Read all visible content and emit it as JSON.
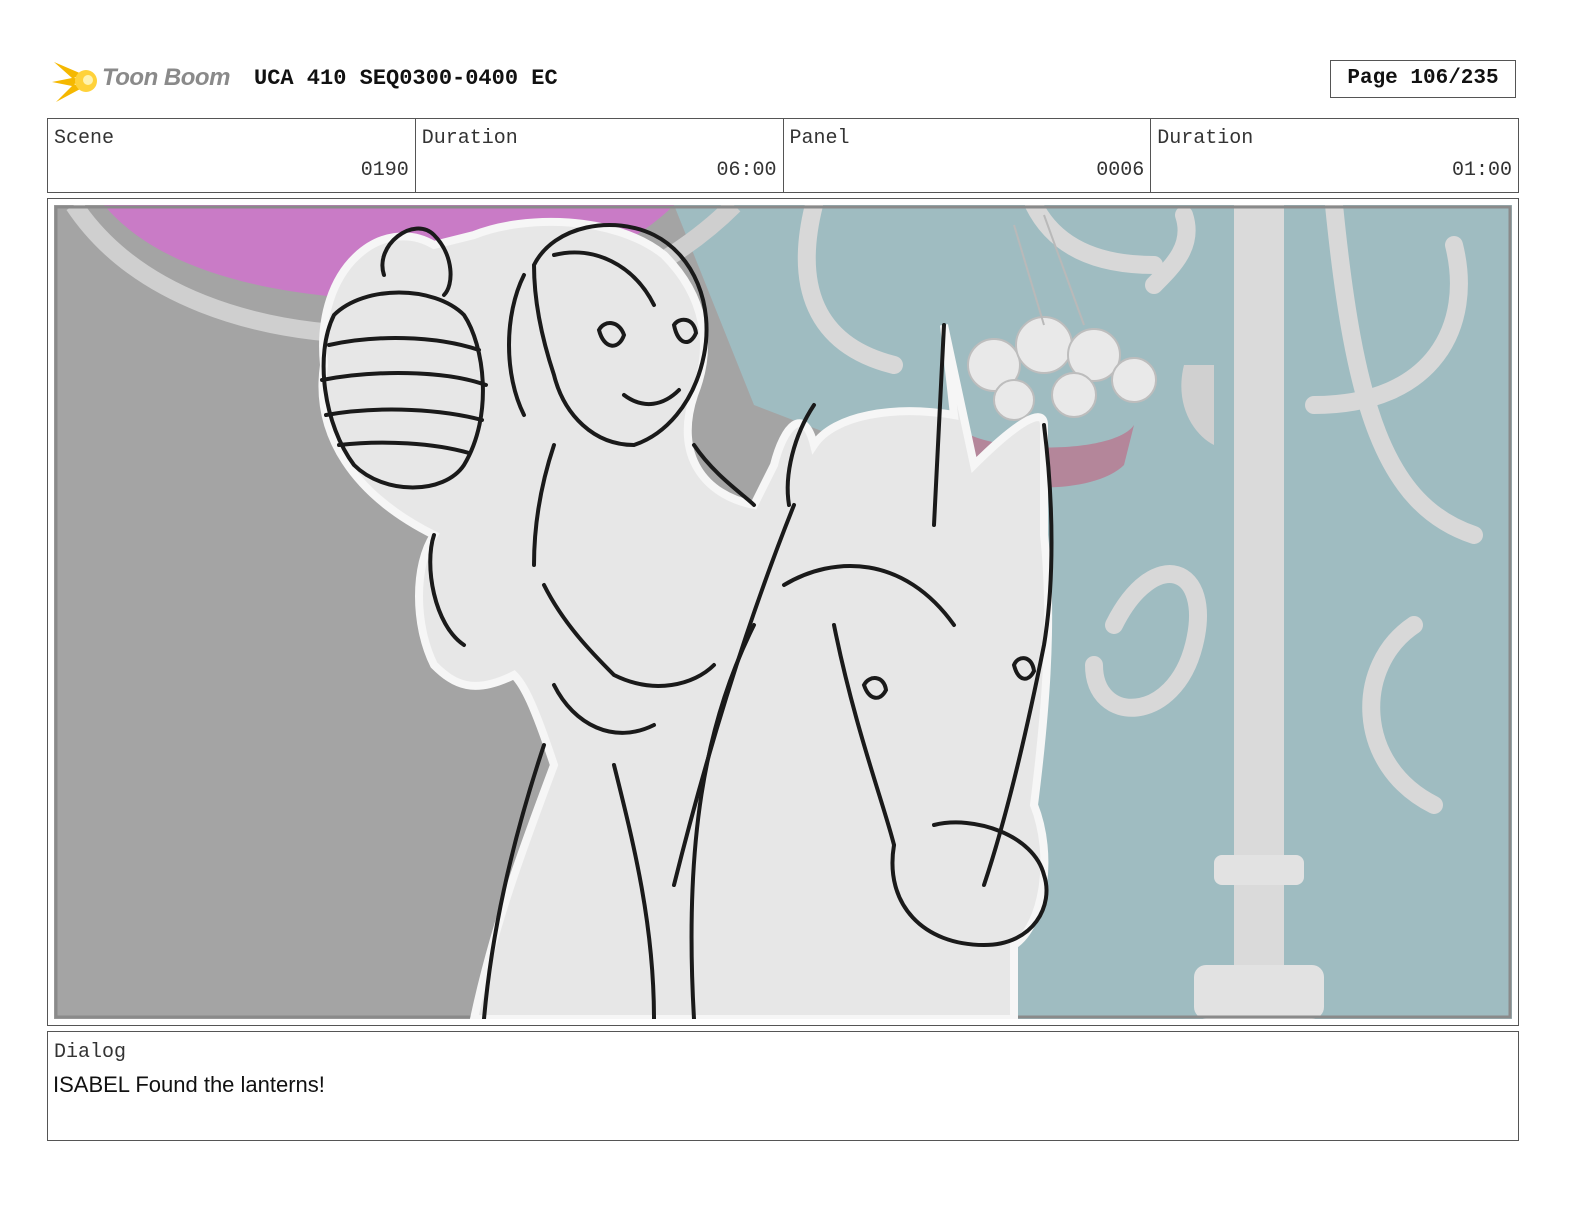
{
  "header": {
    "logo_text": "Toon Boom",
    "title": "UCA 410 SEQ0300-0400 EC",
    "page": "Page 106/235"
  },
  "info": {
    "scene_label": "Scene",
    "scene_value": "0190",
    "scene_duration_label": "Duration",
    "scene_duration_value": "06:00",
    "panel_label": "Panel",
    "panel_value": "0006",
    "panel_duration_label": "Duration",
    "panel_duration_value": "01:00"
  },
  "dialog": {
    "label": "Dialog",
    "text": "ISABEL Found the lanterns!"
  },
  "colors": {
    "accent_logo": "#f5b800",
    "bg_pink": "#c97bc6",
    "bg_teal": "#9fbcc1",
    "bg_grey": "#a4a4a4"
  }
}
